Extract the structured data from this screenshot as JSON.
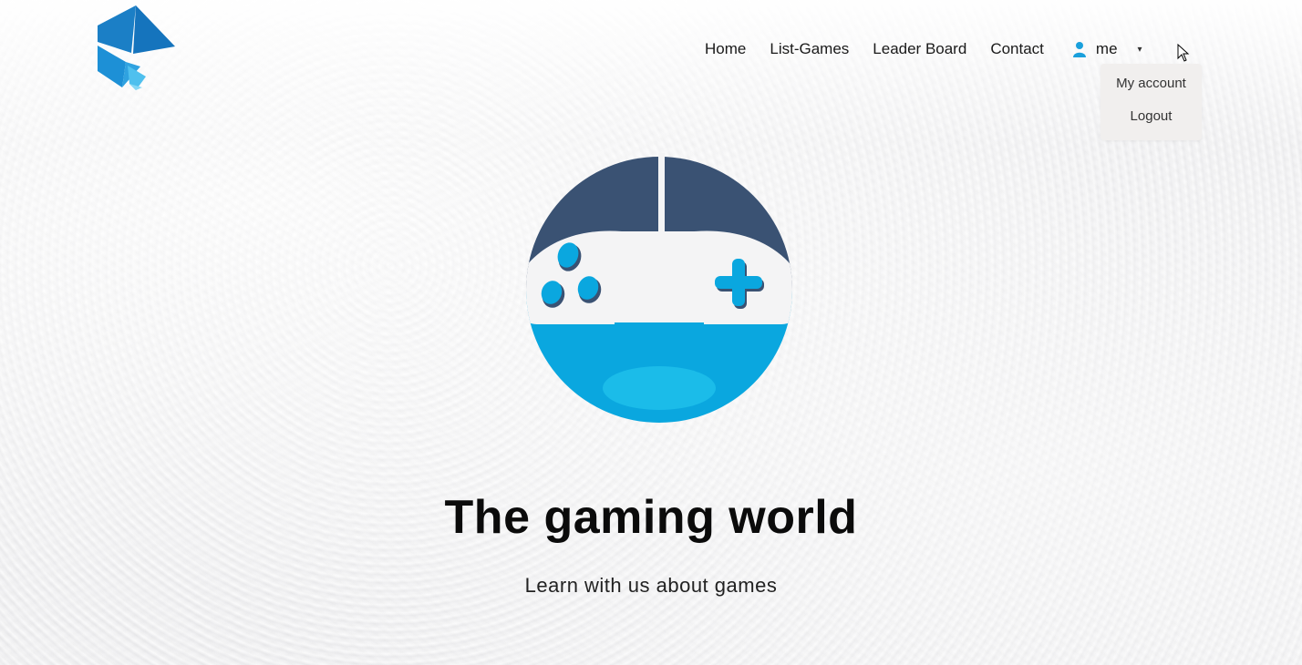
{
  "nav": {
    "items": [
      "Home",
      "List-Games",
      "Leader Board",
      "Contact"
    ],
    "user_label": "me",
    "caret": "▾"
  },
  "dropdown": {
    "items": [
      "My account",
      "Logout"
    ]
  },
  "hero": {
    "title": "The gaming world",
    "subtitle": "Learn with us about games"
  },
  "colors": {
    "navy": "#3a5273",
    "blue": "#0aa7df",
    "light_blue": "#1bbce9",
    "logo_blue": "#1b7fc6"
  },
  "icons": [
    "brand-logo-icon",
    "user-icon",
    "chevron-down-icon",
    "gamepad-icon",
    "cursor-icon"
  ]
}
